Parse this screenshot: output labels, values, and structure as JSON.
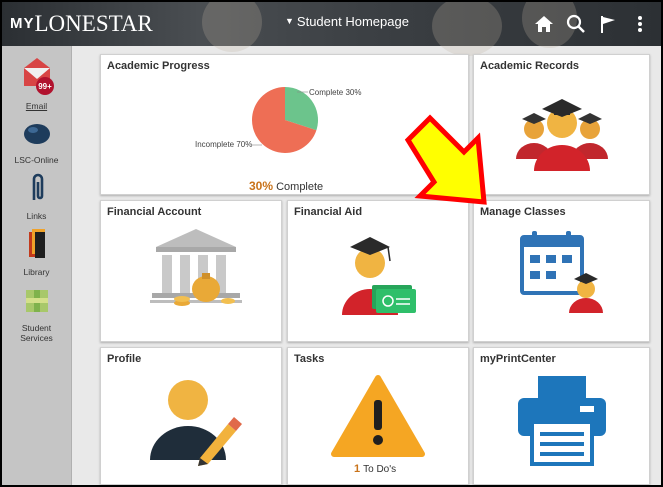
{
  "header": {
    "logo_my": "MY",
    "logo_rest": "LONESTAR",
    "page_title": "Student Homepage"
  },
  "sidebar": {
    "items": [
      {
        "label": "Email",
        "badge": "99+"
      },
      {
        "label": "LSC-Online"
      },
      {
        "label": "Links"
      },
      {
        "label": "Library"
      },
      {
        "label": "Student Services"
      }
    ]
  },
  "tiles": {
    "academic_progress": {
      "title": "Academic Progress",
      "pie_complete_label": "Complete 30%",
      "pie_incomplete_label": "Incomplete 70%",
      "percent": "30%",
      "percent_label": "Complete"
    },
    "academic_records": {
      "title": "Academic Records"
    },
    "financial_account": {
      "title": "Financial Account"
    },
    "financial_aid": {
      "title": "Financial Aid"
    },
    "manage_classes": {
      "title": "Manage Classes"
    },
    "profile": {
      "title": "Profile"
    },
    "tasks": {
      "title": "Tasks",
      "todo_count": "1",
      "todo_label": "To Do's"
    },
    "my_print_center": {
      "title": "myPrintCenter"
    }
  },
  "colors": {
    "pie_complete": "#6cc48c",
    "pie_incomplete": "#ee6e55",
    "accent_orange": "#c9731a",
    "arrow_fill": "#ffff00",
    "arrow_stroke": "#ff0000"
  },
  "chart_data": {
    "type": "pie",
    "categories": [
      "Complete",
      "Incomplete"
    ],
    "values": [
      30,
      70
    ]
  }
}
